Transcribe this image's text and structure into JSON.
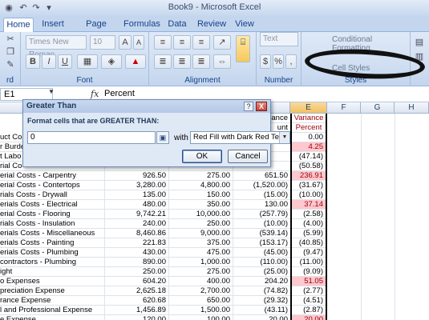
{
  "window": {
    "title": "Book9 - Microsoft Excel"
  },
  "ribbon": {
    "tabs": [
      "Home",
      "Insert",
      "Page Layout",
      "Formulas",
      "Data",
      "Review",
      "View"
    ],
    "active_tab": "Home",
    "font": {
      "name": "Times New Roman",
      "size": "10",
      "bold": "B",
      "italic": "I",
      "underline": "U",
      "grow": "A",
      "shrink": "A"
    },
    "groups": {
      "clipboard": "rd",
      "font": "Font",
      "alignment": "Alignment",
      "number": "Number",
      "styles": "Styles"
    },
    "number_format": "Text",
    "conditional_formatting": "Conditional Formatting",
    "cell_styles": "Cell Styles",
    "percent_symbol": "%",
    "comma_symbol": ","
  },
  "formula_bar": {
    "name_box": "E1",
    "fx": "fx",
    "content": "Percent"
  },
  "sheet": {
    "columns": {
      "e": "E",
      "f": "F",
      "g": "G",
      "h": "H"
    },
    "header_d_top": "ance",
    "header_d_bottom": "unt",
    "header_e_top": "Variance",
    "header_e_bottom": "Percent",
    "rows": [
      {
        "label": "uct Cos",
        "b": "",
        "c": "",
        "d": "0.00",
        "e": "0.00",
        "hl": false
      },
      {
        "label": "r Burde",
        "b": "",
        "c": "",
        "d": "",
        "e": "4.25",
        "hl": true
      },
      {
        "label": "t Labo",
        "b": "",
        "c": "",
        "d": "",
        "e": "(47.14)",
        "hl": false
      },
      {
        "label": "rial Co",
        "b": "",
        "c": "",
        "d": "",
        "e": "(50.58)",
        "hl": false
      },
      {
        "label": "erial Costs - Carpentry",
        "b": "926.50",
        "c": "275.00",
        "d": "651.50",
        "e": "236.91",
        "hl": true
      },
      {
        "label": "erial Costs - Contertops",
        "b": "3,280.00",
        "c": "4,800.00",
        "d": "(1,520.00)",
        "e": "(31.67)",
        "hl": false
      },
      {
        "label": "rials Costs - Drywall",
        "b": "135.00",
        "c": "150.00",
        "d": "(15.00)",
        "e": "(10.00)",
        "hl": false
      },
      {
        "label": "erials Costs - Electrical",
        "b": "480.00",
        "c": "350.00",
        "d": "130.00",
        "e": "37.14",
        "hl": true
      },
      {
        "label": "erial Costs - Flooring",
        "b": "9,742.21",
        "c": "10,000.00",
        "d": "(257.79)",
        "e": "(2.58)",
        "hl": false
      },
      {
        "label": "rials Costs - Insulation",
        "b": "240.00",
        "c": "250.00",
        "d": "(10.00)",
        "e": "(4.00)",
        "hl": false
      },
      {
        "label": "erials Costs - Miscellaneous",
        "b": "8,460.86",
        "c": "9,000.00",
        "d": "(539.14)",
        "e": "(5.99)",
        "hl": false
      },
      {
        "label": "erials Costs - Painting",
        "b": "221.83",
        "c": "375.00",
        "d": "(153.17)",
        "e": "(40.85)",
        "hl": false
      },
      {
        "label": "erials Costs - Plumbing",
        "b": "430.00",
        "c": "475.00",
        "d": "(45.00)",
        "e": "(9.47)",
        "hl": false
      },
      {
        "label": "contractors - Plumbing",
        "b": "890.00",
        "c": "1,000.00",
        "d": "(110.00)",
        "e": "(11.00)",
        "hl": false
      },
      {
        "label": "ight",
        "b": "250.00",
        "c": "275.00",
        "d": "(25.00)",
        "e": "(9.09)",
        "hl": false
      },
      {
        "label": "o Expenses",
        "b": "604.20",
        "c": "400.00",
        "d": "204.20",
        "e": "51.05",
        "hl": true
      },
      {
        "label": "preciation Expense",
        "b": "2,625.18",
        "c": "2,700.00",
        "d": "(74.82)",
        "e": "(2.77)",
        "hl": false
      },
      {
        "label": "rance Expense",
        "b": "620.68",
        "c": "650.00",
        "d": "(29.32)",
        "e": "(4.51)",
        "hl": false
      },
      {
        "label": "l and Professional Expense",
        "b": "1,456.89",
        "c": "1,500.00",
        "d": "(43.11)",
        "e": "(2.87)",
        "hl": false
      },
      {
        "label": "e Expense",
        "b": "120.00",
        "c": "100.00",
        "d": "20.00",
        "e": "20.00",
        "hl": true
      }
    ]
  },
  "dialog": {
    "title": "Greater Than",
    "help": "?",
    "close": "X",
    "prompt": "Format cells that are GREATER THAN:",
    "value": "0",
    "with_label": "with",
    "format": "Red Fill with Dark Red Text",
    "ok": "OK",
    "cancel": "Cancel"
  },
  "colors": {
    "highlight_fill": "#ffc7ce",
    "highlight_text": "#9c0006",
    "ribbon": "#d1dff2"
  }
}
